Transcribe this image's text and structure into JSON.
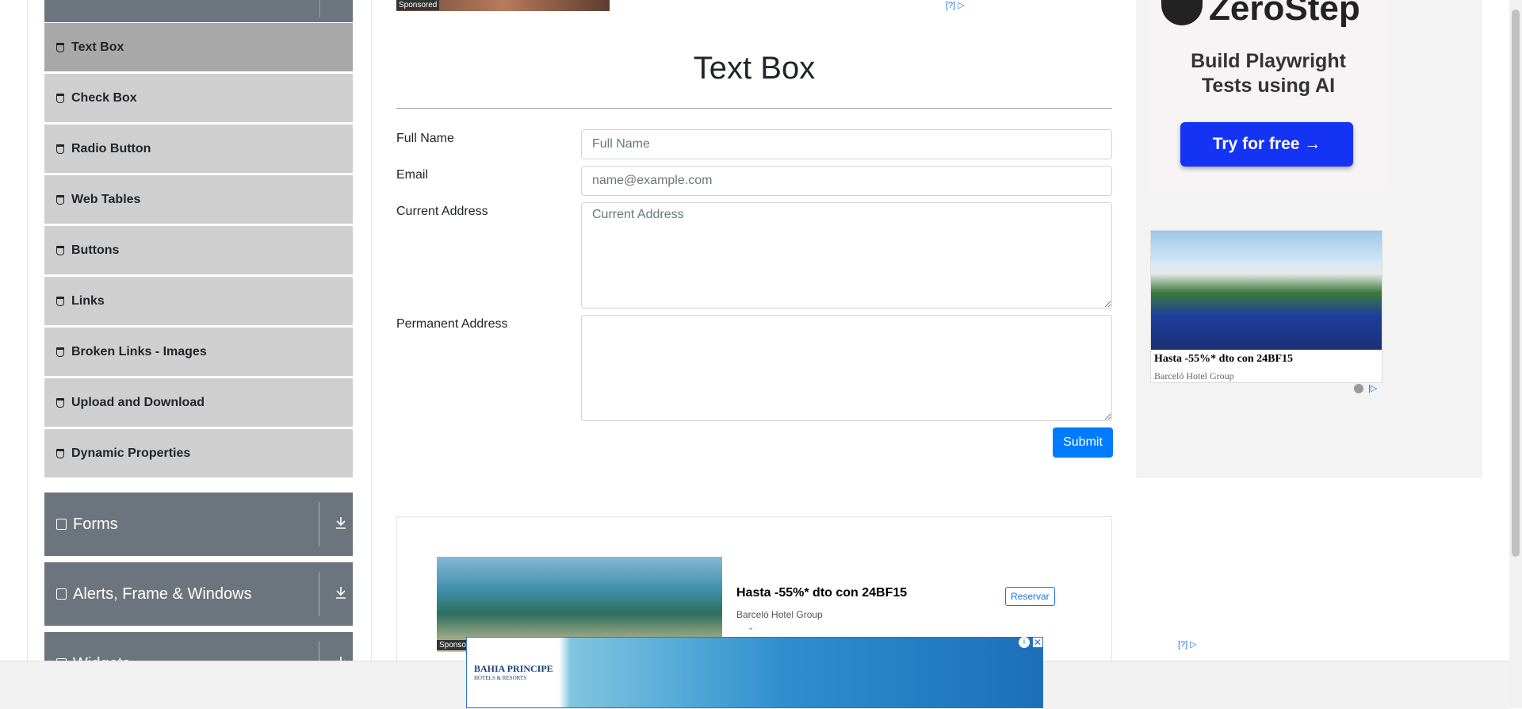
{
  "sidebar": {
    "items": [
      {
        "label": "Text Box",
        "active": true
      },
      {
        "label": "Check Box"
      },
      {
        "label": "Radio Button"
      },
      {
        "label": "Web Tables"
      },
      {
        "label": "Buttons"
      },
      {
        "label": "Links"
      },
      {
        "label": "Broken Links - Images"
      },
      {
        "label": "Upload and Download"
      },
      {
        "label": "Dynamic Properties"
      }
    ],
    "groups": [
      {
        "label": "Forms"
      },
      {
        "label": "Alerts, Frame & Windows"
      },
      {
        "label": "Widgets"
      }
    ]
  },
  "top_ad": {
    "sponsored": "Sponsored",
    "adchoice": "[?]"
  },
  "main": {
    "title": "Text Box",
    "form": {
      "full_name_label": "Full Name",
      "full_name_placeholder": "Full Name",
      "email_label": "Email",
      "email_placeholder": "name@example.com",
      "current_address_label": "Current Address",
      "current_address_placeholder": "Current Address",
      "permanent_address_label": "Permanent Address",
      "submit_label": "Submit"
    }
  },
  "inline_ad": {
    "sponsored": "Sponsored",
    "headline": "Hasta -55%* dto con 24BF15",
    "brand": "Barceló Hotel Group",
    "cta": "Reservar",
    "adchoice": "[?]"
  },
  "right_ad": {
    "brand": "ZeroStep",
    "tagline_1": "Build Playwright",
    "tagline_2": "Tests using AI",
    "cta": "Try for free →",
    "hotel_title": "Hasta -55%* dto con 24BF15",
    "hotel_brand": "Barceló Hotel Group"
  },
  "banner": {
    "logo": "BAHIA PRINCIPE",
    "logo_sub": "HOTELS & RESORTS",
    "close": "✕",
    "info": "i"
  },
  "colors": {
    "primary": "#007bff",
    "sidebar_group": "#6c757d",
    "menu_item": "#cfcfcf",
    "menu_active": "#a8a8a8",
    "cta_blue": "#1433f5"
  }
}
